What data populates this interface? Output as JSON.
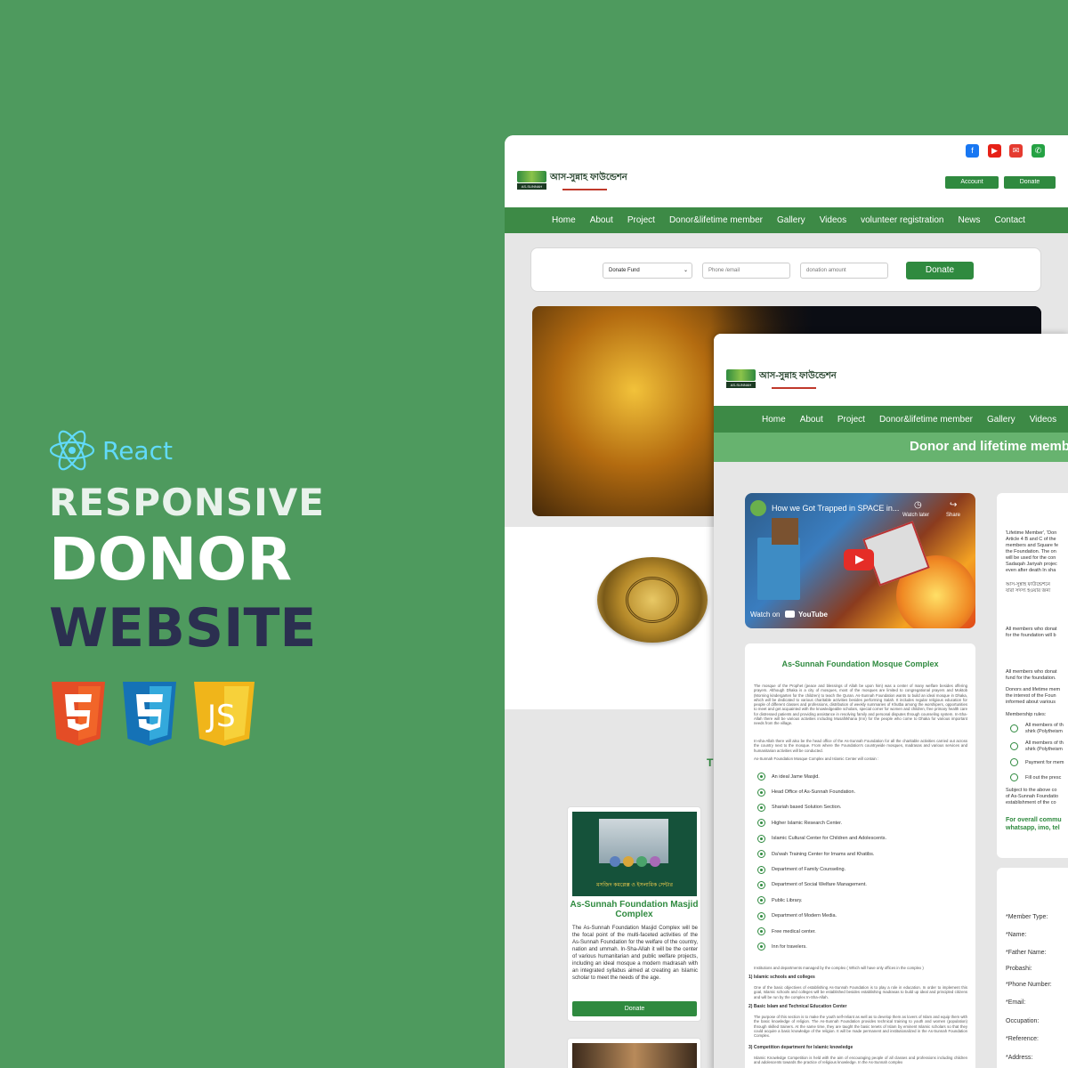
{
  "branding": {
    "react_label": "React",
    "headline_1": "RESPONSIVE",
    "headline_2": "DONOR",
    "headline_3": "WEBSITE",
    "tech_icons": [
      "html5-icon",
      "css3-icon",
      "js-icon"
    ],
    "colors": {
      "background": "#4e9a5e",
      "react": "#61dafb",
      "accent_green": "#2f8a3f",
      "dark_navy": "#2b2f50"
    }
  },
  "site": {
    "logo_bengali": "আস-সুন্নাহ ফাউন্ডেশন",
    "logo_badge": "AS-SUNNAH",
    "social": [
      "facebook-icon",
      "youtube-icon",
      "email-icon",
      "phone-icon"
    ],
    "header_buttons": {
      "account": "Account",
      "donate": "Donate"
    },
    "nav": [
      "Home",
      "About",
      "Project",
      "Donor&lifetime member",
      "Gallery",
      "Videos",
      "volunteer registration",
      "News",
      "Contact"
    ],
    "donate_form": {
      "select_value": "Donate Fund",
      "phone_placeholder": "Phone /email",
      "amount_placeholder": "donation amount",
      "submit": "Donate"
    },
    "project_card": {
      "image_caption": "মসজিদ কমপ্লেক্স ও ইসলামিক সেন্টার",
      "title": "As-Sunnah Foundation Masjid Complex",
      "text": "The As-Sunnah Foundation Masjid Complex will be the focal point of the multi-faceted activities of the As-Sunnah Foundation for the welfare of the country, nation and ummah. In-Sha-Allah it will be the center of various humanitarian and public welfare projects, including an ideal mosque a modern madrasah with an integrated syllabus aimed at creating an Islamic scholar to meet the needs of the age.",
      "button": "Donate"
    },
    "partial_letter": "T"
  },
  "donor_page": {
    "nav": [
      "Home",
      "About",
      "Project",
      "Donor&lifetime member",
      "Gallery",
      "Videos"
    ],
    "banner": "Donor and lifetime memb",
    "video": {
      "title": "How we Got Trapped in SPACE in...",
      "watch_later": "Watch later",
      "share": "Share",
      "watch_on": "Watch on",
      "youtube": "YouTube"
    },
    "mosque": {
      "title": "As-Sunnah Foundation Mosque Complex",
      "intro": "The mosque of the Prophet (peace and blessings of Allah be upon him) was a center of many welfare besides offering prayers. Although Dhaka is a city of mosques, most of the mosques are limited to congregational prayers and Moktob (Morning kindergarten for the children) to teach the Quran. As-Sunnah Foundation wants to build an ideal mosque in Dhaka, which will be dedicated to various charitable activities besides performing Salah. It includes regular religious education for people of different classes and professions, distribution of weekly summaries of Khutba among the worshipers, opportunities to meet and get acquainted with the knowledgeable scholars, special corner for women and children, free primary health care for distressed patients and providing assistance in resolving family and personal disputes through counseling system. In-Sha-Allah there will be various activities including Musafirkhana (Inn) for the people who come to Dhaka for various important needs from the village.",
      "para2": "In-sha-Allah there will also be the head office of the As-Sunnah Foundation for all the charitable activities carried out across the country next to the mosque. From where the Foundation's countrywide mosques, madrasas and various services and humanitarian activities will be conducted.",
      "para3": "As-Sunnah Foundation Mosque Complex and Islamic Center will contain :",
      "items": [
        "An ideal Jame Masjid.",
        "Head Office of As-Sunnah Foundation.",
        "Shariah based Solution Section.",
        "Higher Islamic Research Center.",
        "Islamic Cultural Center for Children and Adolescents.",
        "Da'wah Training Center for Imams and Khatibs.",
        "Department of Family Counseling.",
        "Department of Social Welfare Management.",
        "Public Library.",
        "Department of Modern Media.",
        "Free medical center.",
        "Inn for travelers."
      ],
      "note": "Institutions and departments managed by the complex ( Which will have only offices in the complex )",
      "h1": "1) Islamic schools and colleges",
      "p1": "One of the basic objectives of establishing As-Sunnah Foundation is to play a role in education. In order to implement this goal, Islamic schools and colleges will be established besides establishing madrasas to build up ideal and principled citizens and will be run by the complex In-Sha-Allah.",
      "h2": "2) Basic Islam and Technical Education Center",
      "p2": "The purpose of this section is to make the youth self-reliant as well as to develop them as lovers of Islam and equip them with the basic knowledge of religion. The As-Sunnah Foundation provides technical training to youth and women (population) through skilled trainers. At the same time, they are taught the basic tenets of Islam by eminent Islamic scholars so that they could acquire a basic knowledge of the religion. It will be made permanent and institutionalized in the As-Sunnah Foundation Complex.",
      "h3": "3) Competition department for Islamic knowledge",
      "p3": "Islamic Knowledge Competition is held with the aim of encouraging people of all classes and professions including children and adolescents towards the practice of religious knowledge. In the As-Sunnah complex"
    },
    "sidebar": {
      "p1": [
        "'Lifetime Member', 'Don",
        "Article 4 B and C of the",
        "members and Square fe",
        "the Foundation. The on",
        "will be used for the con",
        "Sadaqah Jariyah projec",
        "even after death In sha"
      ],
      "p1_bn": [
        "আস-সুন্নাহ ফাউন্ডেশনে",
        "যারা সদস্য হওয়ার জন্য"
      ],
      "p2": [
        "All members who donat",
        "for the foundation will b"
      ],
      "p3": [
        "All members who donat",
        "fund for the foundation."
      ],
      "p4": [
        "Donors and lifetime mem",
        "the interest of the Foun",
        "informed about various"
      ],
      "rules_label": "Membership rules:",
      "rules": [
        [
          "All members of th",
          "shirk (Polytheism"
        ],
        [
          "All members of th",
          "shirk (Polytheism"
        ],
        [
          "Payment for mem"
        ],
        [
          "Fill out the presc"
        ]
      ],
      "p5": [
        "Subject to the above co",
        "of As-Sunnah Foundatio",
        "establishment of the co"
      ],
      "contact": [
        "For overall commu",
        "whatsapp, imo, tel"
      ],
      "form_labels": [
        "*Member Type:",
        "*Name:",
        "*Father Name:",
        "Probashi:",
        "*Phone Number:",
        "*Email:",
        "Occupation:",
        "*Reference:",
        "*Address:"
      ]
    }
  }
}
